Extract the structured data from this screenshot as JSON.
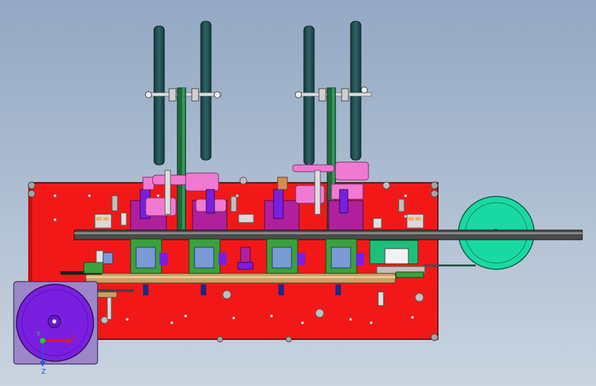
{
  "viewport": {
    "background_top": "#93a8c4",
    "background_bottom": "#c9d4e0"
  },
  "colors": {
    "base_plate": "#f31818",
    "beam": "#4a4a4a",
    "reel_dark": "#1e4a4c",
    "spool_green": "#19d9a2",
    "motor_purple": "#7a1fe0",
    "housing_lavender": "#9a86c8",
    "module_magenta": "#b01f9c",
    "cylinder_pink": "#f07ad2",
    "rail_tan": "#caa166",
    "frame_green": "#3aa23a"
  },
  "axis_triad": {
    "x_label": "X",
    "y_label": "Y",
    "z_label": "Z",
    "x_color": "#e51b1b",
    "y_color": "#1dd11d",
    "z_color": "#2a4ee6"
  }
}
